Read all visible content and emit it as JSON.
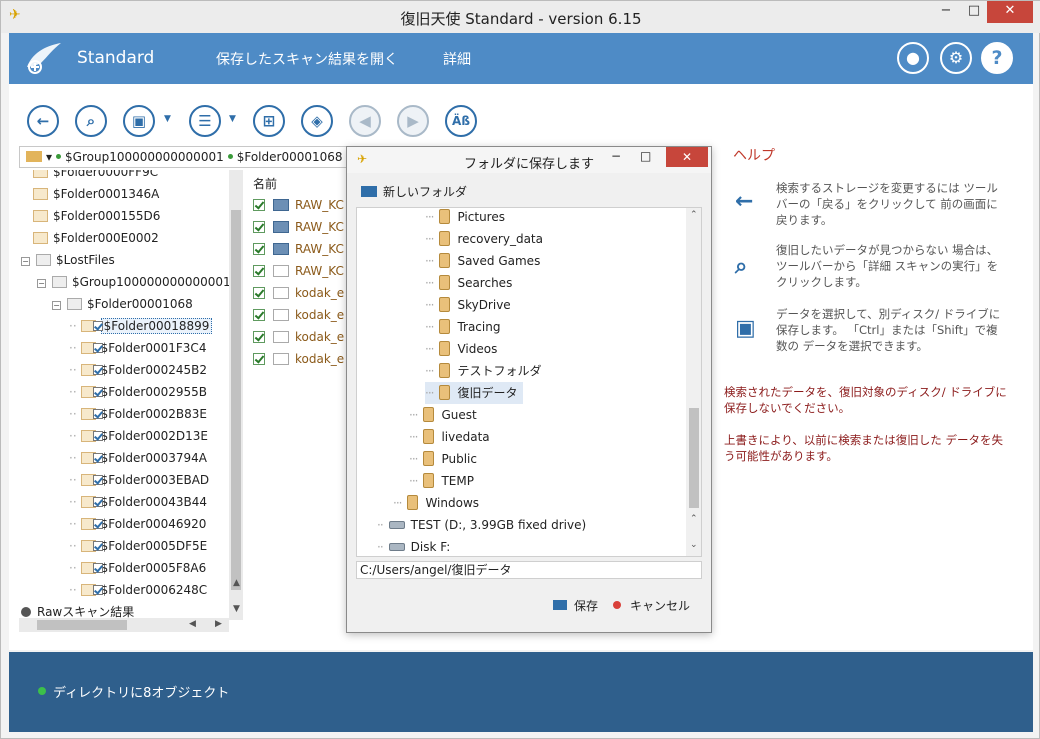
{
  "window": {
    "title": "復旧天使 Standard - version 6.15",
    "minimize": "−",
    "maximize": "□",
    "close": "✕"
  },
  "appbar": {
    "brand": "Standard",
    "menu_open_scan": "保存したスキャン結果を開く",
    "menu_details": "詳細",
    "user_icon": "user-icon",
    "settings_icon": "gear-icon",
    "help_label": "?"
  },
  "toolbar": {
    "back": "←",
    "scan": "⌕",
    "save": "▣",
    "list": "☰",
    "grid": "⊞",
    "binoculars": "◈",
    "prev": "◀",
    "next": "▶",
    "font": "Äß",
    "dropdown": "▼"
  },
  "path_bar": {
    "dropdown": "▾",
    "seg1": "$Group100000000000001",
    "seg2": "$Folder00001068"
  },
  "tree": {
    "items": [
      {
        "label": "$Folder0000FF9C"
      },
      {
        "label": "$Folder0001346A"
      },
      {
        "label": "$Folder000155D6"
      },
      {
        "label": "$Folder000E0002"
      },
      {
        "label": "$LostFiles"
      },
      {
        "label": "$Group100000000000001"
      },
      {
        "label": "$Folder00001068"
      },
      {
        "label": "$Folder00018899"
      },
      {
        "label": "$Folder0001F3C4"
      },
      {
        "label": "$Folder000245B2"
      },
      {
        "label": "$Folder0002955B"
      },
      {
        "label": "$Folder0002B83E"
      },
      {
        "label": "$Folder0002D13E"
      },
      {
        "label": "$Folder0003794A"
      },
      {
        "label": "$Folder0003EBAD"
      },
      {
        "label": "$Folder00043B44"
      },
      {
        "label": "$Folder00046920"
      },
      {
        "label": "$Folder0005DF5E"
      },
      {
        "label": "$Folder0005F8A6"
      },
      {
        "label": "$Folder0006248C"
      },
      {
        "label": "Rawスキャン結果"
      }
    ]
  },
  "files": {
    "header": "名前",
    "rows": [
      {
        "name": "RAW_KC"
      },
      {
        "name": "RAW_KC"
      },
      {
        "name": "RAW_KC"
      },
      {
        "name": "RAW_KC"
      },
      {
        "name": "kodak_e"
      },
      {
        "name": "kodak_e"
      },
      {
        "name": "kodak_e"
      },
      {
        "name": "kodak_e"
      }
    ]
  },
  "help": {
    "title": "ヘルプ",
    "back_text": "検索するストレージを変更するには ツールバーの「戻る」をクリックして 前の画面に戻ります。",
    "scan_text": "復旧したいデータが見つからない 場合は、ツールバーから「詳細 スキャンの実行」をクリックします。",
    "save_text": "データを選択して、別ディスク/ ドライブに保存します。 「Ctrl」または「Shift」で複数の データを選択できます。",
    "warn1": "検索されたデータを、復旧対象のディスク/ ドライブに保存しないでください。",
    "warn2": "上書きにより、以前に検索または復旧した データを失う可能性があります。",
    "back_icon": "←",
    "scan_icon": "⌕",
    "save_icon": "▣"
  },
  "status": {
    "text": "ディレクトリに8オブジェクト"
  },
  "dialog": {
    "title": "フォルダに保存します",
    "close": "✕",
    "new_folder": "新しいフォルダ",
    "tree": [
      {
        "label": "Pictures"
      },
      {
        "label": "recovery_data"
      },
      {
        "label": "Saved Games"
      },
      {
        "label": "Searches"
      },
      {
        "label": "SkyDrive"
      },
      {
        "label": "Tracing"
      },
      {
        "label": "Videos"
      },
      {
        "label": "テストフォルダ"
      },
      {
        "label": "復旧データ"
      },
      {
        "label": "Guest"
      },
      {
        "label": "livedata"
      },
      {
        "label": "Public"
      },
      {
        "label": "TEMP"
      },
      {
        "label": "Windows"
      },
      {
        "label": "TEST (D:, 3.99GB fixed drive)"
      },
      {
        "label": "Disk F:"
      }
    ],
    "path": "C:/Users/angel/復旧データ",
    "save": "保存",
    "cancel": "キャンセル"
  }
}
